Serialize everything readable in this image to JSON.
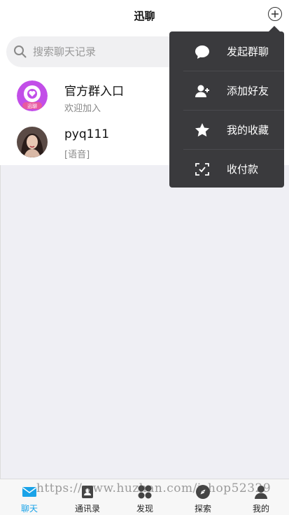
{
  "header": {
    "title": "迅聊",
    "plus_icon": "plus-circle-icon"
  },
  "search": {
    "placeholder": "搜索聊天记录",
    "value": ""
  },
  "chats": [
    {
      "name": "官方群入口",
      "preview": "欢迎加入",
      "avatar_text": "迅聊",
      "avatar_color": "#b04be0"
    },
    {
      "name": "pyq111",
      "preview": "[语音]"
    }
  ],
  "menu": {
    "items": [
      {
        "label": "发起群聊",
        "icon": "chat-bubble-icon"
      },
      {
        "label": "添加好友",
        "icon": "add-user-icon"
      },
      {
        "label": "我的收藏",
        "icon": "star-icon"
      },
      {
        "label": "收付款",
        "icon": "scan-pay-icon"
      }
    ]
  },
  "tabs": [
    {
      "label": "聊天",
      "icon": "envelope-icon",
      "active": true
    },
    {
      "label": "通讯录",
      "icon": "contacts-icon",
      "active": false
    },
    {
      "label": "发现",
      "icon": "discover-icon",
      "active": false
    },
    {
      "label": "探索",
      "icon": "explore-icon",
      "active": false
    },
    {
      "label": "我的",
      "icon": "profile-icon",
      "active": false
    }
  ],
  "watermark": "https://www.huzhan.com/ishop52329",
  "colors": {
    "accent": "#1aa3e8",
    "menu_bg": "#3a3a3d",
    "page_bg": "#efeff4"
  }
}
